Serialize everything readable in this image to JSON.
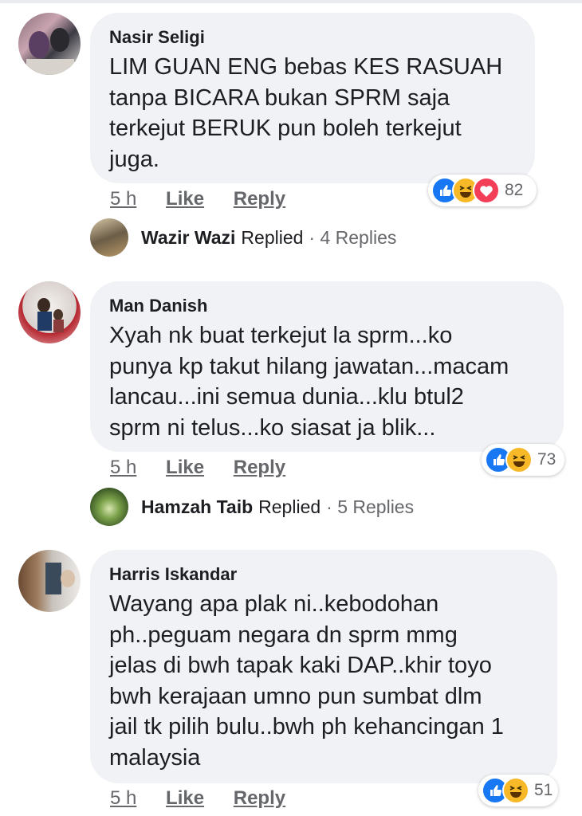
{
  "comments": [
    {
      "author": "Nasir Seligi",
      "text": "LIM GUAN ENG bebas KES RASUAH\ntanpa BICARA bukan SPRM saja\nterkejut BERUK pun boleh terkejut\njuga.",
      "time": "5 h",
      "like_label": "Like",
      "reply_label": "Reply",
      "reactions": [
        "like",
        "haha",
        "love"
      ],
      "reaction_count": "82",
      "reply": {
        "name": "Wazir Wazi",
        "action": "Replied",
        "count": "· 4 Replies"
      }
    },
    {
      "author": "Man Danish",
      "text": "Xyah nk buat terkejut la sprm...ko\npunya kp takut hilang jawatan...macam\nlancau...ini semua dunia...klu btul2\nsprm ni telus...ko siasat ja blik...",
      "time": "5 h",
      "like_label": "Like",
      "reply_label": "Reply",
      "reactions": [
        "like",
        "haha"
      ],
      "reaction_count": "73",
      "reply": {
        "name": "Hamzah Taib",
        "action": "Replied",
        "count": "· 5 Replies"
      }
    },
    {
      "author": "Harris Iskandar",
      "text": "Wayang apa plak ni..kebodohan\nph..peguam negara dn sprm mmg\njelas di bwh tapak kaki DAP..khir toyo\nbwh kerajaan umno pun sumbat dlm\njail tk pilih bulu..bwh ph kehancingan 1\nmalaysia",
      "time": "5 h",
      "like_label": "Like",
      "reply_label": "Reply",
      "reactions": [
        "like",
        "haha"
      ],
      "reaction_count": "51"
    }
  ],
  "colors": {
    "like": "#1877f2",
    "haha": "#f7b928",
    "love": "#f33e58",
    "bubble": "#f0f2f5"
  }
}
